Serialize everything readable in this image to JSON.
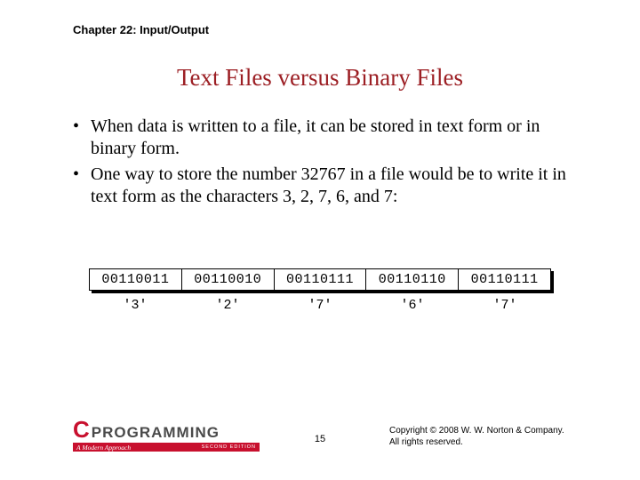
{
  "chapter": "Chapter 22: Input/Output",
  "title": "Text Files versus Binary Files",
  "bullets": [
    "When data is written to a file, it can be stored in text form or in binary form.",
    "One way to store the number 32767 in a file would be to write it in text form as the characters 3, 2, 7, 6, and 7:"
  ],
  "bytes": [
    "00110011",
    "00110010",
    "00110111",
    "00110110",
    "00110111"
  ],
  "chars": [
    "'3'",
    "'2'",
    "'7'",
    "'6'",
    "'7'"
  ],
  "logo": {
    "c": "C",
    "prog": "PROGRAMMING",
    "sub": "A Modern Approach",
    "ed": "SECOND EDITION"
  },
  "page": "15",
  "copyright": "Copyright © 2008 W. W. Norton & Company.\nAll rights reserved."
}
